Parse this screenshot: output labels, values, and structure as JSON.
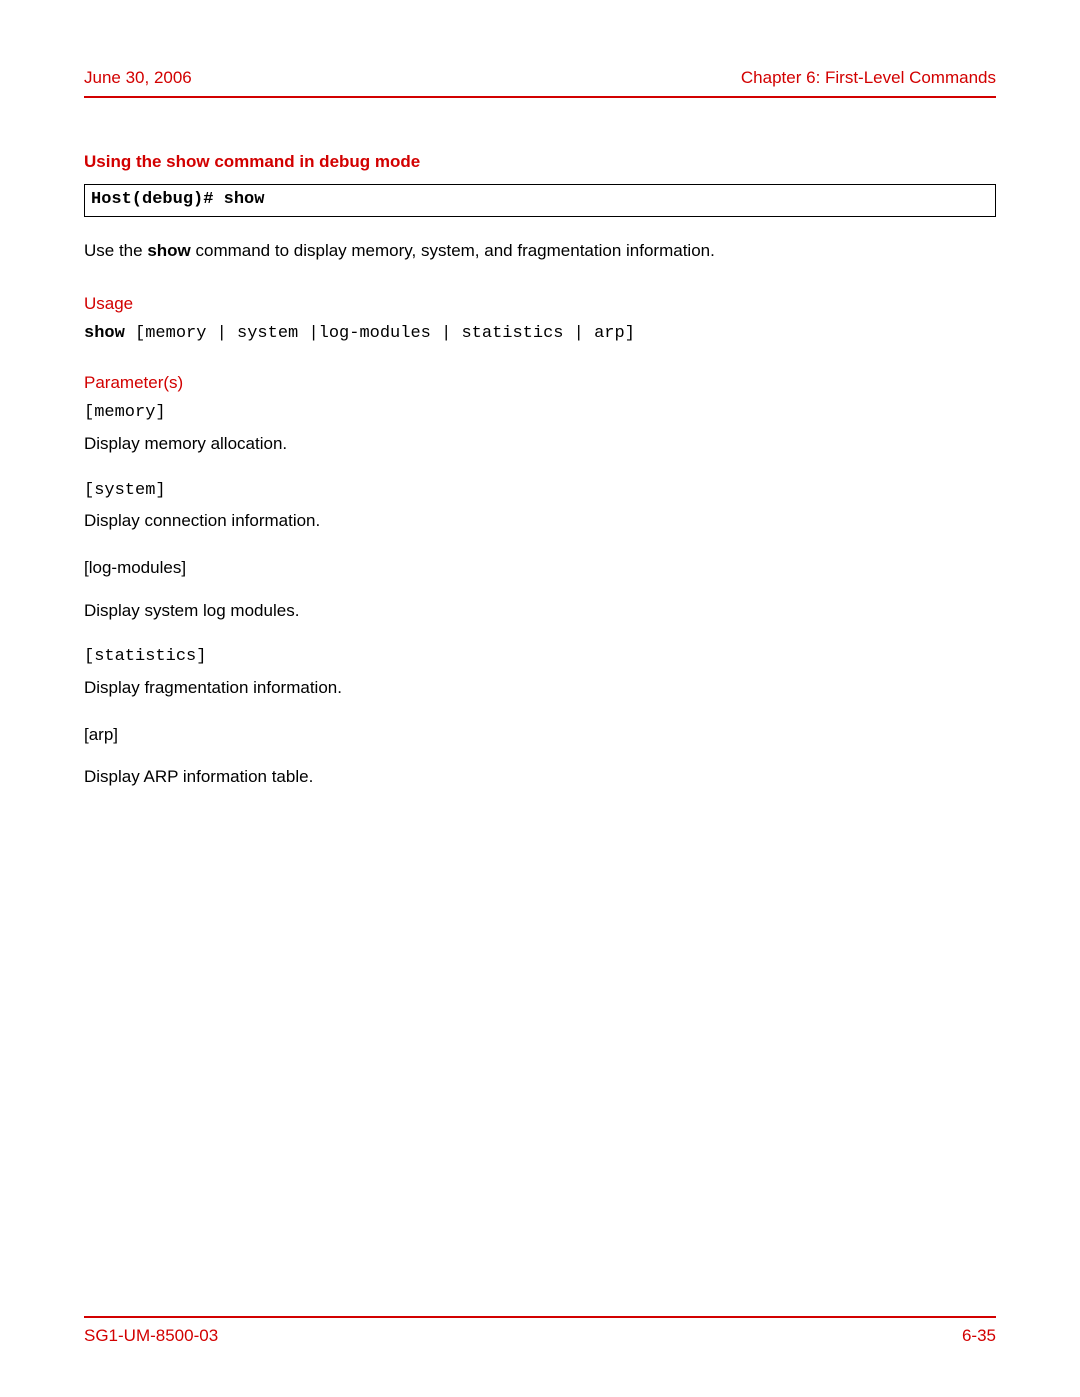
{
  "header": {
    "date": "June 30, 2006",
    "chapter": "Chapter 6: First-Level Commands"
  },
  "section": {
    "title": "Using the show command in debug mode",
    "commandBox": "Host(debug)# show",
    "intro_pre": "Use the ",
    "intro_bold": "show",
    "intro_post": " command to display memory, system, and fragmentation information."
  },
  "usage": {
    "heading": "Usage",
    "bold": "show",
    "rest": " [memory | system |log-modules | statistics | arp]"
  },
  "parameters": {
    "heading": "Parameter(s)",
    "items": [
      {
        "name": "[memory]",
        "mono": true,
        "desc": "Display memory allocation."
      },
      {
        "name": "[system]",
        "mono": true,
        "desc": "Display connection information."
      },
      {
        "name": "[log-modules]",
        "mono": false,
        "desc": "Display  system log modules."
      },
      {
        "name": "[statistics]",
        "mono": true,
        "desc": "Display fragmentation information."
      },
      {
        "name": "[arp]",
        "mono": false,
        "desc": "Display ARP information table."
      }
    ]
  },
  "footer": {
    "doc": "SG1-UM-8500-03",
    "page": "6-35"
  }
}
